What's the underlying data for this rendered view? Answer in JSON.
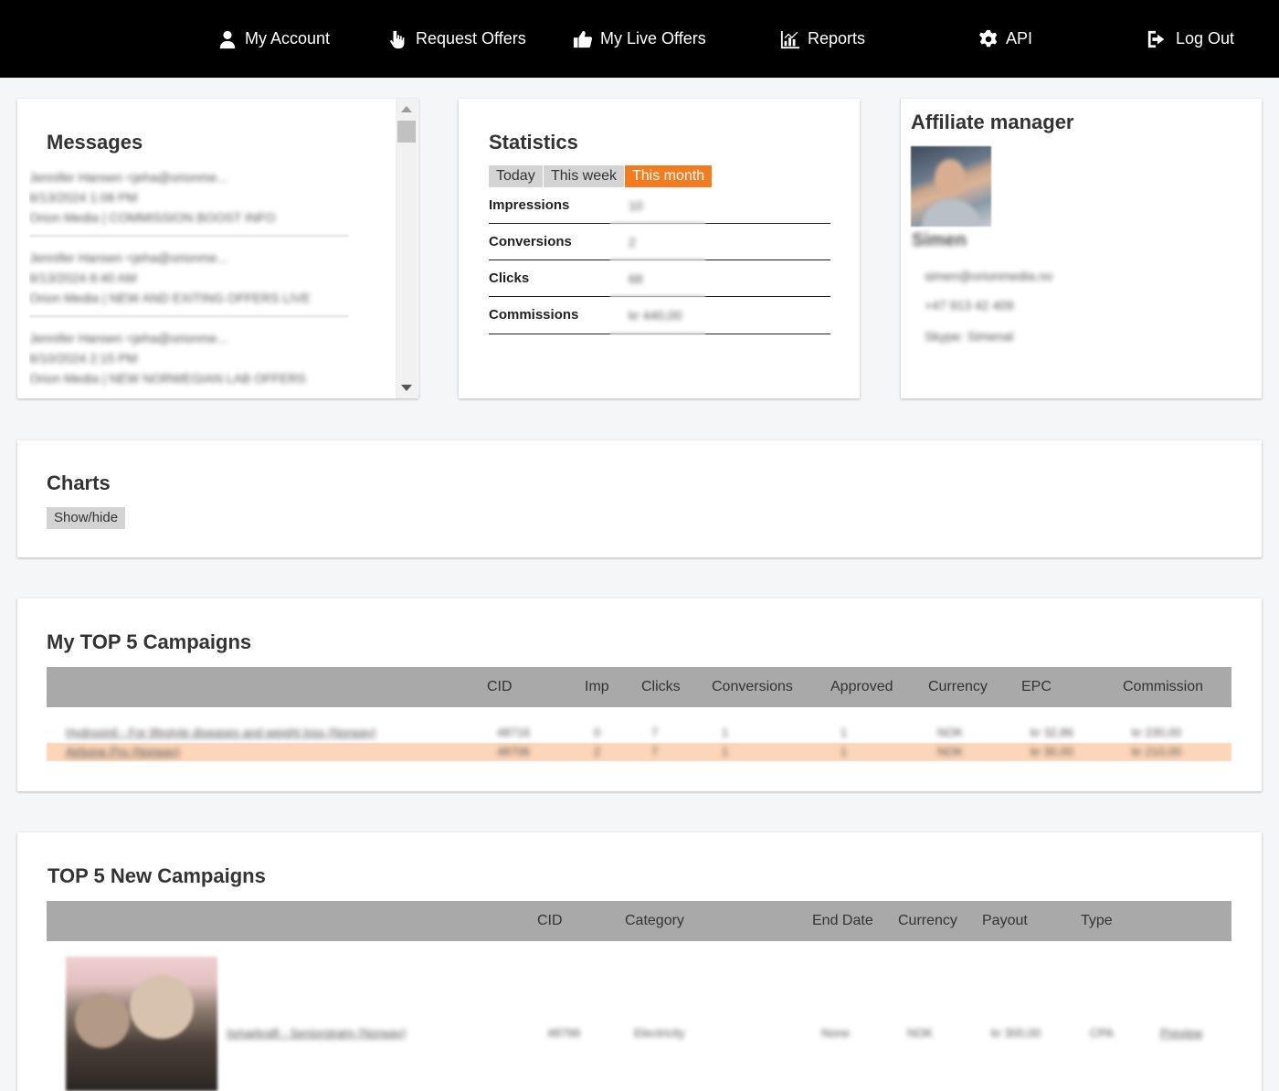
{
  "nav": {
    "items": [
      {
        "label": "My Account",
        "icon": "user-icon"
      },
      {
        "label": "Request Offers",
        "icon": "hand-pointer-icon"
      },
      {
        "label": "My Live Offers",
        "icon": "thumbs-up-icon"
      },
      {
        "label": "Reports",
        "icon": "chart-icon"
      },
      {
        "label": "API",
        "icon": "gear-icon"
      },
      {
        "label": "Log Out",
        "icon": "sign-out-icon"
      }
    ]
  },
  "messages": {
    "title": "Messages",
    "items": [
      {
        "from": "Jennifer Hansen <jeha@orionme...",
        "date": "6/13/2024 1:08 PM",
        "subject": "Orion Media | COMMISSION BOOST INFO"
      },
      {
        "from": "Jennifer Hansen <jeha@orionme...",
        "date": "6/13/2024 8:40 AM",
        "subject": "Orion Media | NEW AND EXITING OFFERS LIVE"
      },
      {
        "from": "Jennifer Hansen <jeha@orionme...",
        "date": "6/10/2024 2:15 PM",
        "subject": "Orion Media | NEW NORWEGIAN LAB OFFERS"
      }
    ]
  },
  "statistics": {
    "title": "Statistics",
    "tabs": [
      "Today",
      "This week",
      "This month"
    ],
    "active_tab": "This month",
    "rows": [
      {
        "label": "Impressions",
        "value": "10"
      },
      {
        "label": "Conversions",
        "value": "2"
      },
      {
        "label": "Clicks",
        "value": "68"
      },
      {
        "label": "Commissions",
        "value": "kr 440,00"
      }
    ]
  },
  "manager": {
    "title": "Affiliate manager",
    "name": "Simen",
    "email": "simen@orionmedia.no",
    "phone": "+47 913 42 409",
    "skype": "Skype: Simenal"
  },
  "charts": {
    "title": "Charts",
    "toggle_label": "Show/hide"
  },
  "top_campaigns": {
    "title": "My TOP 5 Campaigns",
    "columns": [
      "CID",
      "Imp",
      "Clicks",
      "Conversions",
      "Approved",
      "Currency",
      "EPC",
      "Commission"
    ],
    "rows": [
      {
        "name": "Hydroxinil - For lifestyle diseases and weight loss (Norway)",
        "cid": "48716",
        "imp": "0",
        "clicks": "7",
        "conversions": "1",
        "approved": "1",
        "currency": "NOK",
        "epc": "kr 32,86",
        "commission": "kr 230,00"
      },
      {
        "name": "Airbone Pro (Norway)",
        "cid": "48706",
        "imp": "2",
        "clicks": "7",
        "conversions": "1",
        "approved": "1",
        "currency": "NOK",
        "epc": "kr 30,00",
        "commission": "kr 210,00"
      }
    ]
  },
  "new_campaigns": {
    "title": "TOP 5 New Campaigns",
    "columns": [
      "CID",
      "Category",
      "End Date",
      "Currency",
      "Payout",
      "Type"
    ],
    "rows": [
      {
        "name": "Ismarkraft - Seniorstrøm (Norway)",
        "cid": "48799",
        "category": "Electricity",
        "end_date": "None",
        "currency": "NOK",
        "payout": "kr 300,00",
        "type": "CPA",
        "action": "Preview"
      }
    ]
  }
}
